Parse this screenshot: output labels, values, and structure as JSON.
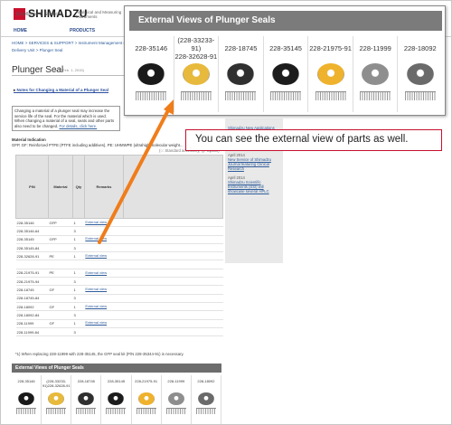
{
  "site": {
    "logo_text": "SHIMADZU",
    "tagline": "Excellence in Science",
    "subtitle": "Analytical and Measuring Instruments",
    "nav": [
      "HOME",
      "PRODUCTS",
      "INDUSTRIES"
    ],
    "breadcrumb": "HOME > SERVICES & SUPPORT > Instrument Management (Hardware) > ...",
    "breadcrumb2": "Delivery Unit > Plunger Seal"
  },
  "page": {
    "title": "Plunger Seal",
    "date": "(as of Feb. 1, 2015)",
    "hplc": "HPLC Sy...",
    "notes_link": "Notes for Changing a Material of a Plunger Seal",
    "intro": "Changing a material of a plunger seal may increase the service life of the seal. For the material which is used. When changing a material of a seal, seats and other parts also need to be changed.",
    "intro_link": "For details, click here.",
    "material_title": "Material Indication",
    "material_text": "GFP, GF: Reinforced PTFE (PTFE including additives), PE: UHMWPE (ultrahigh molecular weight...",
    "std_acc": "(○: Standard accessory, ◎: Option)",
    "footnote": "*1) When replacing 228-11999 with 228-35145, the GFP seal kit (P/N 228-35344-91) is necessary."
  },
  "table": {
    "headers": [
      "P/N",
      "Material",
      "Qty",
      "Remarks"
    ],
    "rows": [
      [
        "228-35146",
        "GFP",
        "1",
        "External view"
      ],
      [
        "228-35146-64",
        "",
        "3",
        ""
      ],
      [
        "228-35145",
        "GFP",
        "1",
        "External view"
      ],
      [
        "228-35145-84",
        "",
        "3",
        ""
      ],
      [
        "228-32628-91",
        "PE",
        "1",
        "External view"
      ],
      [
        "",
        "",
        "",
        ""
      ],
      [
        "228-21975-91",
        "PE",
        "1",
        "External view"
      ],
      [
        "228-21975-94",
        "",
        "3",
        ""
      ],
      [
        "228-18745",
        "GF",
        "1",
        "External view"
      ],
      [
        "228-18745-84",
        "",
        "3",
        ""
      ],
      [
        "228-18092",
        "GF",
        "1",
        "External view"
      ],
      [
        "228-18092-84",
        "",
        "3",
        ""
      ],
      [
        "228-11999",
        "GF",
        "1",
        "External view"
      ],
      [
        "228-11999-84",
        "",
        "3",
        ""
      ]
    ]
  },
  "sidebar": {
    "items": [
      {
        "date": "",
        "text": "Shimadzu New Applications"
      },
      {
        "date": "April 2014",
        "text": "Join our Program to find Innovative Technologies"
      },
      {
        "date": "April 2014",
        "text": "New Service of Shimadzu Journal featuring Clinical Research"
      },
      {
        "date": "April 2014",
        "text": "Shimadzu Scientific Instruments (SSI) will showcase several HPLC"
      }
    ]
  },
  "popup": {
    "title": "External Views of Plunger Seals",
    "parts": [
      {
        "pn": "228-35146",
        "pn2": "",
        "color": "#1a1a1a"
      },
      {
        "pn": "(228-33233-91)",
        "pn2": "228-32628-91",
        "color": "#e7b93c"
      },
      {
        "pn": "228-18745",
        "pn2": "",
        "color": "#303030"
      },
      {
        "pn": "228-35145",
        "pn2": "",
        "color": "#1c1c1c"
      },
      {
        "pn": "228-21975-91",
        "pn2": "",
        "color": "#efb22d"
      },
      {
        "pn": "228-11999",
        "pn2": "",
        "color": "#8e8e8e"
      },
      {
        "pn": "228-18092",
        "pn2": "",
        "color": "#6a6a6a"
      }
    ]
  },
  "strip_title": "External Views of Plunger Seals",
  "callout": "You can see the external view of parts as well.",
  "colors": {
    "accent": "#c8102e",
    "header_gray": "#7b7b7b",
    "link": "#2f5c9a"
  }
}
